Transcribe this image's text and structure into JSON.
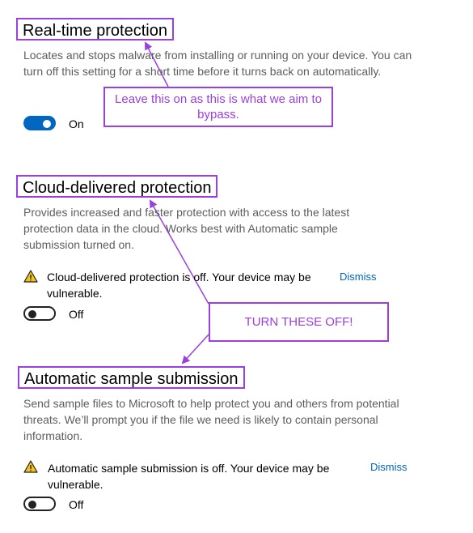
{
  "realtime": {
    "title": "Real-time protection",
    "description": "Locates and stops malware from installing or running on your device. You can turn off this setting for a short time before it turns back on automatically.",
    "toggle_state": "On"
  },
  "cloud": {
    "title": "Cloud-delivered protection",
    "description": "Provides increased and faster protection with access to the latest protection data in the cloud. Works best with Automatic sample submission turned on.",
    "warning": "Cloud-delivered protection is off. Your device may be vulnerable.",
    "dismiss": "Dismiss",
    "toggle_state": "Off"
  },
  "sample": {
    "title": "Automatic sample submission",
    "description": "Send sample files to Microsoft to help protect you and others from potential threats. We’ll prompt you if the file we need is likely to contain personal information.",
    "warning": "Automatic sample submission is off. Your device may be vulnerable.",
    "dismiss": "Dismiss",
    "toggle_state": "Off"
  },
  "annotations": {
    "leave_on": "Leave this on as this is what we aim to bypass.",
    "turn_off": "TURN THESE OFF!",
    "color": "#9b3fe0"
  },
  "colors": {
    "accent": "#0067c0",
    "warning": "#f2c318"
  }
}
